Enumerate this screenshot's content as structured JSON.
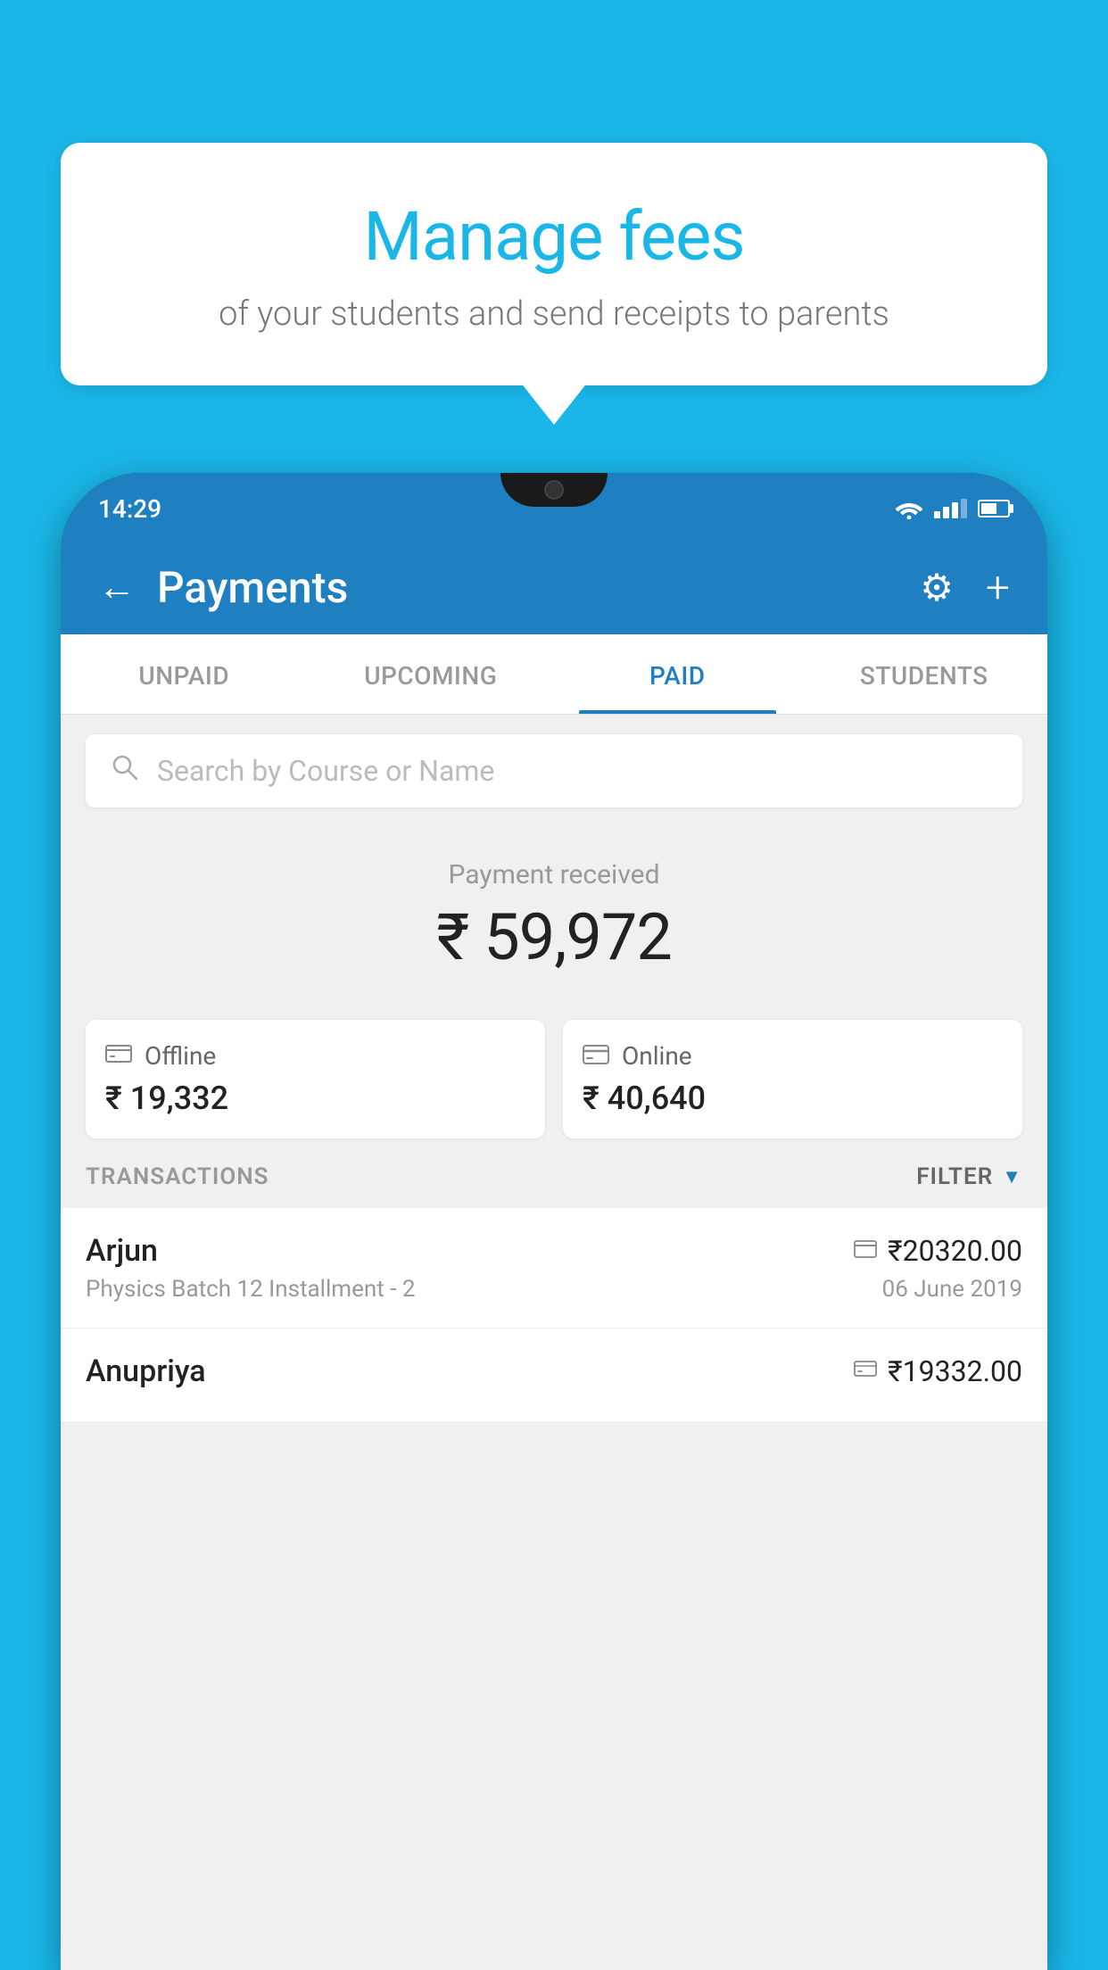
{
  "page": {
    "background_color": "#1ab6e8"
  },
  "speech_bubble": {
    "title": "Manage fees",
    "subtitle": "of your students and send receipts to parents"
  },
  "status_bar": {
    "time": "14:29"
  },
  "header": {
    "title": "Payments",
    "back_label": "←",
    "gear_label": "⚙",
    "plus_label": "+"
  },
  "tabs": [
    {
      "label": "UNPAID",
      "active": false
    },
    {
      "label": "UPCOMING",
      "active": false
    },
    {
      "label": "PAID",
      "active": true
    },
    {
      "label": "STUDENTS",
      "active": false
    }
  ],
  "search": {
    "placeholder": "Search by Course or Name"
  },
  "payment_received": {
    "label": "Payment received",
    "amount": "₹ 59,972"
  },
  "payment_cards": [
    {
      "type": "Offline",
      "amount": "₹ 19,332",
      "icon": "cash"
    },
    {
      "type": "Online",
      "amount": "₹ 40,640",
      "icon": "card"
    }
  ],
  "transactions_section": {
    "label": "TRANSACTIONS",
    "filter_label": "FILTER"
  },
  "transactions": [
    {
      "name": "Arjun",
      "course": "Physics Batch 12 Installment - 2",
      "amount": "₹20320.00",
      "date": "06 June 2019",
      "icon": "card"
    },
    {
      "name": "Anupriya",
      "course": "",
      "amount": "₹19332.00",
      "date": "",
      "icon": "cash"
    }
  ]
}
